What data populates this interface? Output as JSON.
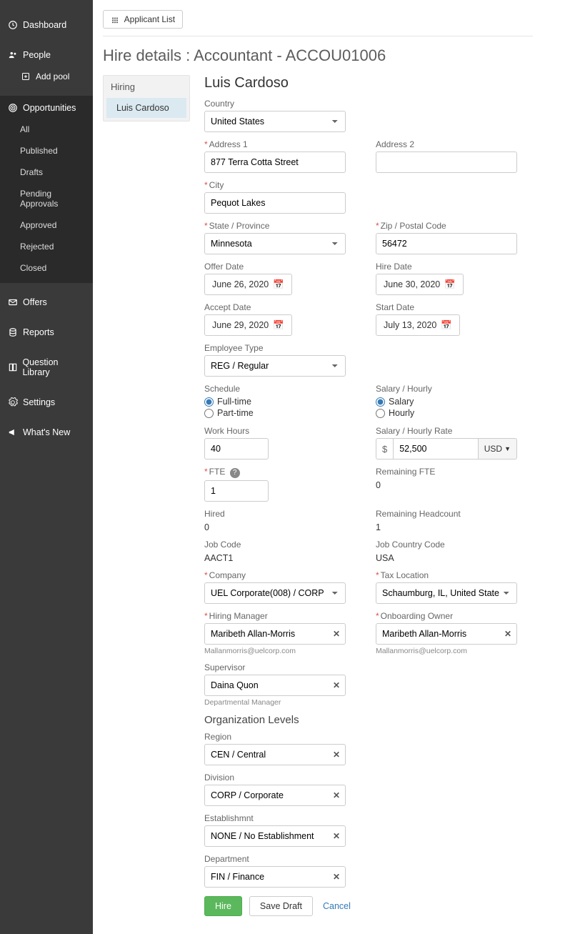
{
  "nav": {
    "dashboard": "Dashboard",
    "people": "People",
    "add_pool": "Add pool",
    "opportunities": "Opportunities",
    "opp_items": [
      "All",
      "Published",
      "Drafts",
      "Pending Approvals",
      "Approved",
      "Rejected",
      "Closed"
    ],
    "offers": "Offers",
    "reports": "Reports",
    "question_library": "Question Library",
    "settings": "Settings",
    "whats_new": "What's New"
  },
  "top_button": "Applicant List",
  "page_title": "Hire details : Accountant - ACCOU01006",
  "panel": {
    "header": "Hiring",
    "selected": "Luis Cardoso"
  },
  "person_name": "Luis Cardoso",
  "labels": {
    "country": "Country",
    "address1": "Address 1",
    "address2": "Address 2",
    "city": "City",
    "state": "State / Province",
    "zip": "Zip / Postal Code",
    "offer_date": "Offer Date",
    "hire_date": "Hire Date",
    "accept_date": "Accept Date",
    "start_date": "Start Date",
    "employee_type": "Employee Type",
    "schedule": "Schedule",
    "salary_hourly": "Salary / Hourly",
    "work_hours": "Work Hours",
    "salary_rate": "Salary / Hourly Rate",
    "fte": "FTE",
    "remaining_fte": "Remaining FTE",
    "hired": "Hired",
    "remaining_headcount": "Remaining Headcount",
    "job_code": "Job Code",
    "job_country_code": "Job Country Code",
    "company": "Company",
    "tax_location": "Tax Location",
    "hiring_manager": "Hiring Manager",
    "onboarding_owner": "Onboarding Owner",
    "supervisor": "Supervisor",
    "org_levels": "Organization Levels",
    "region": "Region",
    "division": "Division",
    "establishment": "Establishmnt",
    "department": "Department"
  },
  "values": {
    "country": "United States",
    "address1": "877 Terra Cotta Street",
    "address2": "",
    "city": "Pequot Lakes",
    "state": "Minnesota",
    "zip": "56472",
    "offer_date": "June 26, 2020",
    "hire_date": "June 30, 2020",
    "accept_date": "June 29, 2020",
    "start_date": "July 13, 2020",
    "employee_type": "REG / Regular",
    "schedule_full": "Full-time",
    "schedule_part": "Part-time",
    "sal_salary": "Salary",
    "sal_hourly": "Hourly",
    "work_hours": "40",
    "salary_rate": "52,500",
    "currency": "USD",
    "fte": "1",
    "remaining_fte": "0",
    "hired": "0",
    "remaining_headcount": "1",
    "job_code": "AACT1",
    "job_country_code": "USA",
    "company": "UEL Corporate(008) / CORP",
    "tax_location": "Schaumburg, IL, United States (Chicago,",
    "hiring_manager": "Maribeth Allan-Morris",
    "hiring_manager_email": "Mallanmorris@uelcorp.com",
    "onboarding_owner": "Maribeth Allan-Morris",
    "onboarding_owner_email": "Mallanmorris@uelcorp.com",
    "supervisor": "Daina Quon",
    "supervisor_role": "Departmental Manager",
    "region": "CEN / Central",
    "division": "CORP / Corporate",
    "establishment": "NONE / No Establishment",
    "department": "FIN / Finance"
  },
  "actions": {
    "hire": "Hire",
    "save_draft": "Save Draft",
    "cancel": "Cancel"
  }
}
